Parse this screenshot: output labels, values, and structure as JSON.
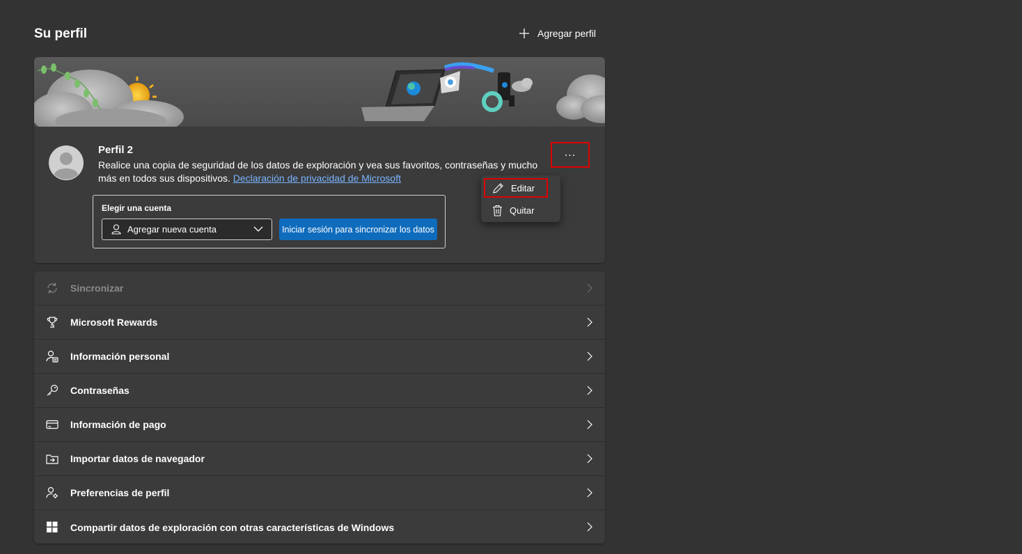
{
  "header": {
    "title": "Su perfil",
    "add_profile_label": "Agregar perfil"
  },
  "profile": {
    "name": "Perfil 2",
    "description": "Realice una copia de seguridad de los datos de exploración y vea sus favoritos, contraseñas y mucho más en todos sus dispositivos.",
    "privacy_link": "Declaración de privacidad de Microsoft",
    "more_label": "..."
  },
  "account": {
    "label": "Elegir una cuenta",
    "selected": "Agregar nueva cuenta",
    "signin_button": "Iniciar sesión para sincronizar los datos"
  },
  "context_menu": {
    "edit": "Editar",
    "remove": "Quitar"
  },
  "settings": {
    "items": [
      {
        "label": "Sincronizar",
        "icon": "sync-icon",
        "disabled": true
      },
      {
        "label": "Microsoft Rewards",
        "icon": "trophy-icon"
      },
      {
        "label": "Información personal",
        "icon": "person-card-icon"
      },
      {
        "label": "Contraseñas",
        "icon": "key-icon"
      },
      {
        "label": "Información de pago",
        "icon": "credit-card-icon"
      },
      {
        "label": "Importar datos de navegador",
        "icon": "import-folder-icon"
      },
      {
        "label": "Preferencias de perfil",
        "icon": "person-settings-icon"
      },
      {
        "label": "Compartir datos de exploración con otras características de Windows",
        "icon": "windows-icon"
      }
    ]
  },
  "colors": {
    "background": "#333333",
    "card": "#3b3b3b",
    "accent": "#0f6cbd",
    "link": "#78b4ff",
    "highlight": "#e00000"
  }
}
